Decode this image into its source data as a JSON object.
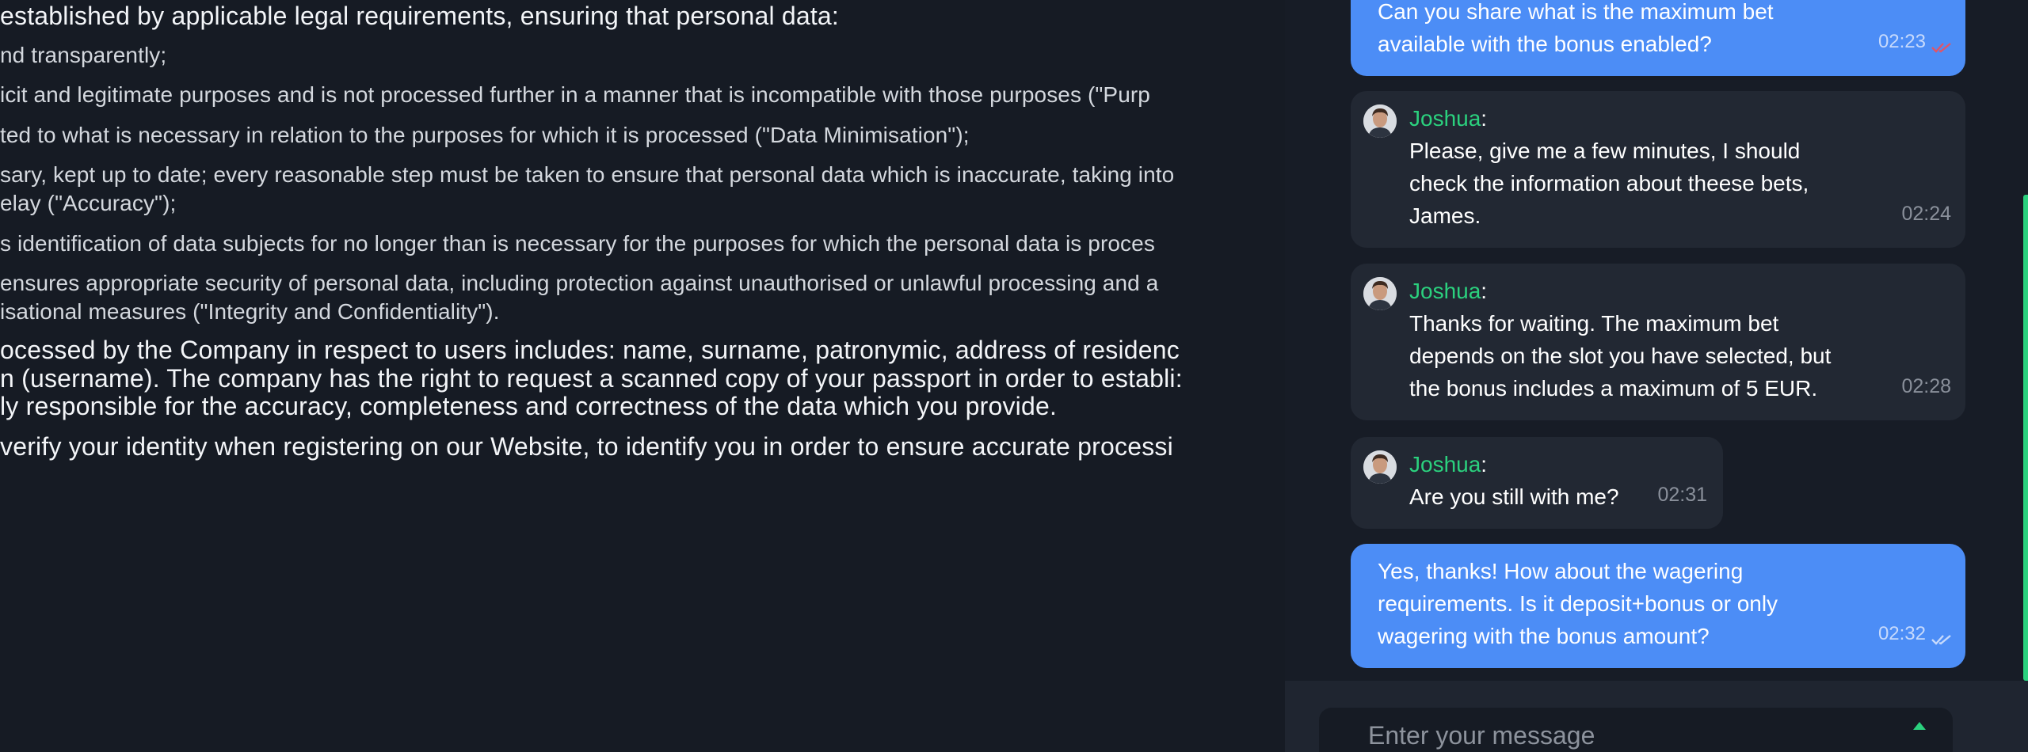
{
  "document": {
    "lines": [
      "established by applicable legal requirements, ensuring that personal data:",
      "nd transparently;",
      "icit and legitimate purposes and is not processed further in a manner that is incompatible with those purposes (\"Purp",
      "ted to what is necessary in relation to the purposes for which it is processed (\"Data Minimisation\");",
      "sary, kept up to date; every reasonable step must be taken to ensure that personal data which is inaccurate, taking into",
      "elay (\"Accuracy\");",
      "s identification of data subjects for no longer than is necessary for the purposes for which the personal data is proces",
      "ensures appropriate security of personal data, including protection against unauthorised or unlawful processing and a",
      "isational measures (\"Integrity and Confidentiality\").",
      "ocessed by the Company in respect to users includes: name, surname, patronymic, address of residenc",
      "n (username). The company has the right to request a scanned copy of your passport in order to establi:",
      "ly responsible for the accuracy, completeness and correctness of the data which you provide.",
      "verify your identity when registering on our Website, to identify you in order to ensure accurate processi"
    ]
  },
  "chat": {
    "messages": [
      {
        "sender": "user",
        "text": "Can you share what is the maximum bet\navailable with the bonus enabled?",
        "time": "02:23"
      },
      {
        "sender": "agent",
        "author": "Joshua",
        "text": "Please, give me a few minutes, I should\ncheck the information about theese bets,\nJames.",
        "time": "02:24"
      },
      {
        "sender": "agent",
        "author": "Joshua",
        "text": "Thanks for waiting. The maximum bet\ndepends on the slot you have selected, but\nthe bonus includes a maximum of 5 EUR.",
        "time": "02:28"
      },
      {
        "sender": "agent",
        "author": "Joshua",
        "text": "Are you still with me?",
        "time": "02:31"
      },
      {
        "sender": "user",
        "text": "Yes, thanks! How about the wagering\nrequirements. Is it deposit+bonus or only\nwagering with the bonus amount?",
        "time": "02:32"
      }
    ],
    "input": {
      "placeholder": "Enter your message"
    }
  },
  "colors": {
    "background": "#161b24",
    "user_bubble": "#4c8df6",
    "agent_bubble": "#222833",
    "accent_green": "#2bd17e"
  },
  "icons": {
    "read_receipt": "double-check-icon",
    "avatar": "agent-avatar",
    "send": "send-icon"
  }
}
